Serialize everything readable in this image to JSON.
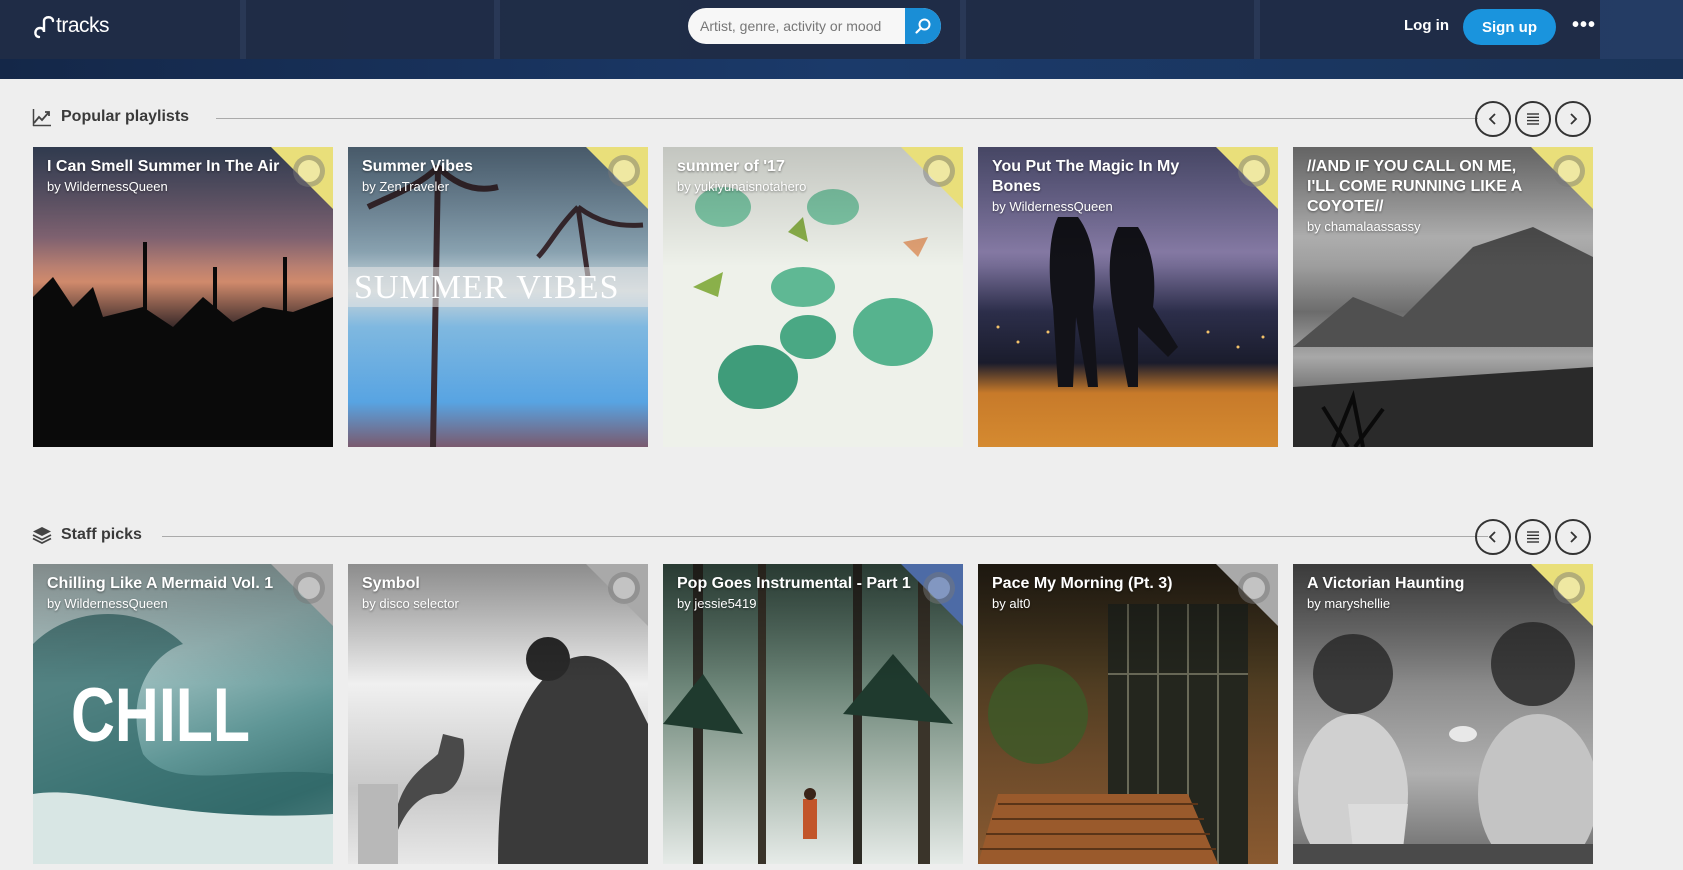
{
  "header": {
    "logo_text": "tracks",
    "search_placeholder": "Artist, genre, activity or mood",
    "login_label": "Log in",
    "signup_label": "Sign up",
    "more_label": "•••"
  },
  "sections": [
    {
      "title": "Popular playlists",
      "icon": "trending-up-icon",
      "cards": [
        {
          "title": "I Can Smell Summer In The Air",
          "by": "by WildernessQueen",
          "corner": "yellow"
        },
        {
          "title": "Summer Vibes",
          "by": "by ZenTraveler",
          "corner": "yellow",
          "art_text": "SUMMER VIBES"
        },
        {
          "title": "summer of '17",
          "by": "by yukiyunaisnotahero",
          "corner": "yellow"
        },
        {
          "title": "You Put The Magic In My Bones",
          "by": "by WildernessQueen",
          "corner": "yellow"
        },
        {
          "title": "//AND IF YOU CALL ON ME, I'LL COME RUNNING LIKE A COYOTE//",
          "by": "by chamalaassassy",
          "corner": "yellow"
        }
      ]
    },
    {
      "title": "Staff picks",
      "icon": "layers-icon",
      "cards": [
        {
          "title": "Chilling Like A Mermaid Vol. 1",
          "by": "by WildernessQueen",
          "corner": "gray",
          "art_text": "CHILL"
        },
        {
          "title": "Symbol",
          "by": "by disco selector",
          "corner": "gray"
        },
        {
          "title": "Pop Goes Instrumental - Part 1",
          "by": "by jessie5419",
          "corner": "blue"
        },
        {
          "title": "Pace My Morning (Pt. 3)",
          "by": "by alt0",
          "corner": "gray"
        },
        {
          "title": "A Victorian Haunting",
          "by": "by maryshellie",
          "corner": "yellow"
        }
      ]
    }
  ],
  "controls": {
    "prev_icon": "chevron-left-icon",
    "list_icon": "list-icon",
    "next_icon": "chevron-right-icon"
  }
}
